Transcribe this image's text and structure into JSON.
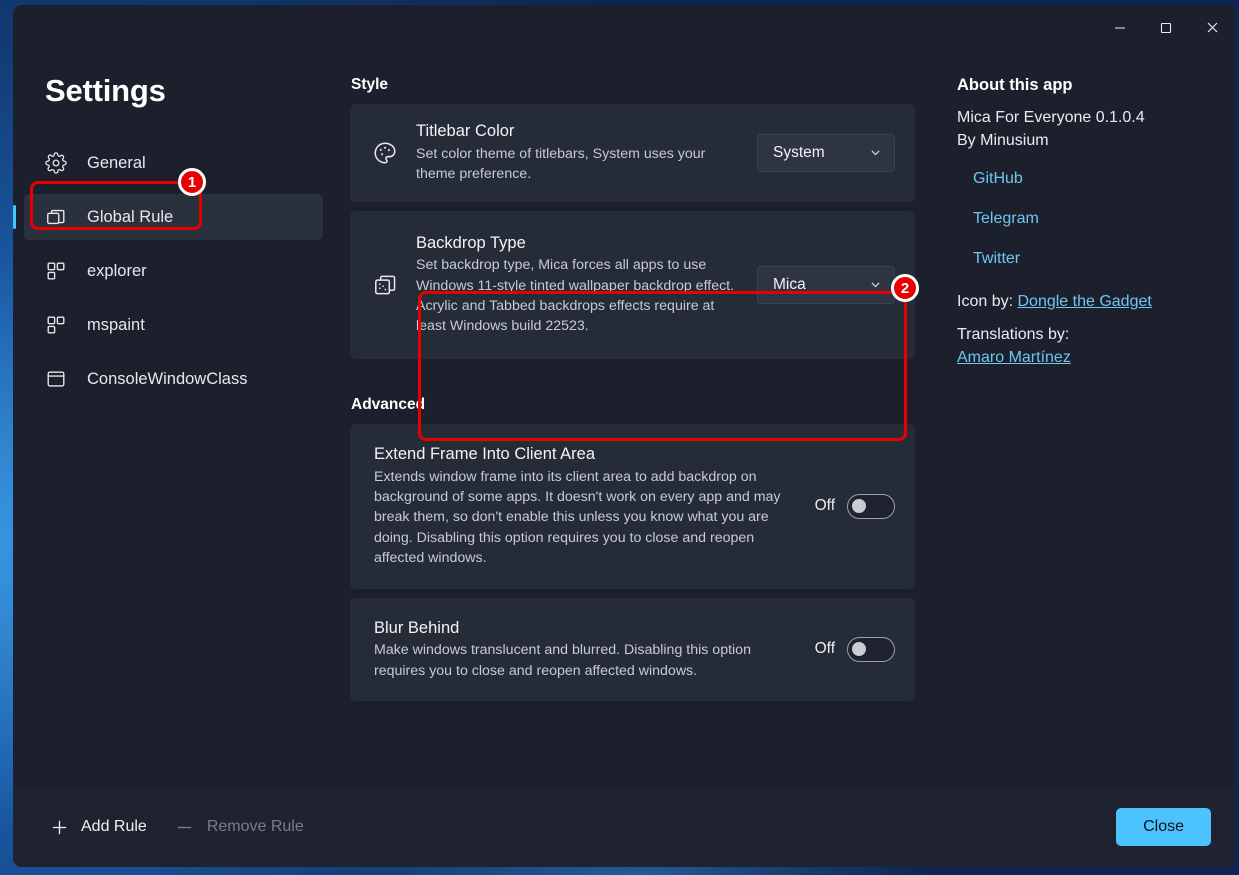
{
  "window": {
    "title": "Settings",
    "caption_buttons": [
      {
        "name": "minimize",
        "glyph": "minimize-icon"
      },
      {
        "name": "maximize",
        "glyph": "maximize-icon"
      },
      {
        "name": "close",
        "glyph": "close-icon"
      }
    ]
  },
  "accent_color": "#4cc2ff",
  "annotation_color": "#e60000",
  "sidebar": {
    "items": [
      {
        "label": "General",
        "icon": "gear-icon",
        "selected": false
      },
      {
        "label": "Global Rule",
        "icon": "window-stack-icon",
        "selected": true
      },
      {
        "label": "explorer",
        "icon": "app-grid-icon",
        "selected": false
      },
      {
        "label": "mspaint",
        "icon": "app-grid-icon",
        "selected": false
      },
      {
        "label": "ConsoleWindowClass",
        "icon": "console-window-icon",
        "selected": false
      }
    ]
  },
  "main": {
    "sections": [
      {
        "key": "style",
        "heading": "Style"
      },
      {
        "key": "advanced",
        "heading": "Advanced"
      }
    ],
    "titlebar_color": {
      "title": "Titlebar Color",
      "description": "Set color theme of titlebars, System uses your theme preference.",
      "icon": "palette-icon",
      "dropdown_value": "System"
    },
    "backdrop_type": {
      "title": "Backdrop Type",
      "description": "Set backdrop type, Mica forces all apps to use Windows 11-style tinted wallpaper backdrop effect.\nAcrylic and Tabbed backdrops effects require at least Windows build 22523.",
      "icon": "backdrop-stack-icon",
      "dropdown_value": "Mica"
    },
    "extend_frame": {
      "title": "Extend Frame Into Client Area",
      "description": "Extends window frame into its client area to add backdrop on background of some apps. It doesn't work on every app and may break them, so don't enable this unless you know what you are doing. Disabling this option requires you to close and reopen affected windows.",
      "toggle_label": "Off",
      "toggle_state": "off"
    },
    "blur_behind": {
      "title": "Blur Behind",
      "description": "Make windows translucent and blurred. Disabling this option requires you to close and reopen affected windows.",
      "toggle_label": "Off",
      "toggle_state": "off"
    }
  },
  "about": {
    "heading": "About this app",
    "app_line": "Mica For Everyone 0.1.0.4",
    "author_line": "By Minusium",
    "links": [
      {
        "label": "GitHub"
      },
      {
        "label": "Telegram"
      },
      {
        "label": "Twitter"
      }
    ],
    "icon_credit_prefix": "Icon by: ",
    "icon_credit_link": "Dongle the Gadget",
    "translation_credit_prefix": "Translations by:",
    "translation_credit_link": "Amaro Martínez"
  },
  "footer": {
    "add_rule": {
      "label": "Add Rule",
      "icon": "plus-icon",
      "enabled": true
    },
    "remove_rule": {
      "label": "Remove Rule",
      "icon": "minus-icon",
      "enabled": false
    },
    "close": {
      "label": "Close"
    }
  },
  "annotations": [
    {
      "number": "1",
      "target": "sidebar-item-global-rule"
    },
    {
      "number": "2",
      "target": "backdrop-type-card"
    }
  ]
}
